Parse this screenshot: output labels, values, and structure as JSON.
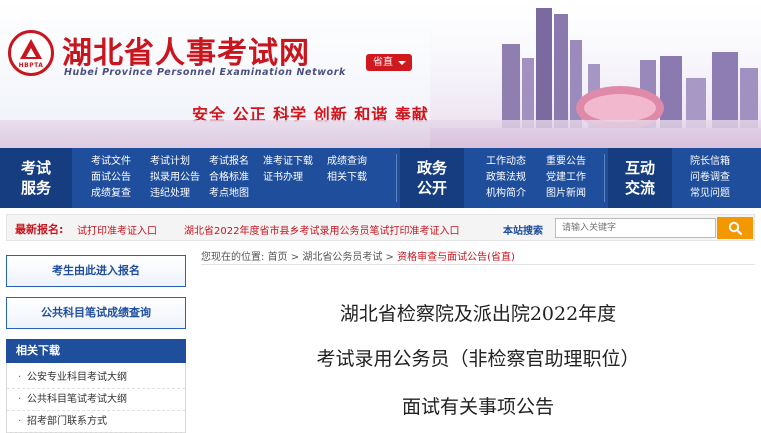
{
  "header": {
    "logo_abbr": "HBPTA",
    "site_title": "湖北省人事考试网",
    "site_subtitle": "Hubei Province Personnel Examination Network",
    "city_select": "省直",
    "slogan": "安全  公正  科学  创新  和谐  奉献"
  },
  "nav": {
    "groups": [
      {
        "title": [
          "考试",
          "服务"
        ],
        "links": [
          "考试文件",
          "考试计划",
          "考试报名",
          "准考证下载",
          "成绩查询",
          "面试公告",
          "拟录用公告",
          "合格标准",
          "证书办理",
          "相关下载",
          "成绩复查",
          "违纪处理",
          "考点地图"
        ]
      },
      {
        "title": [
          "政务",
          "公开"
        ],
        "links": [
          "工作动态",
          "重要公告",
          "政策法规",
          "党建工作",
          "机构简介",
          "图片新闻"
        ]
      },
      {
        "title": [
          "互动",
          "交流"
        ],
        "links": [
          "院长信箱",
          "问卷调查",
          "常见问题"
        ]
      }
    ]
  },
  "latest": {
    "label": "最新报名:",
    "items": [
      "试打印准考证入口",
      "湖北省2022年度省市县乡考试录用公务员笔试打印准考证入口"
    ],
    "search_label": "本站搜索",
    "search_placeholder": "请输入关键字"
  },
  "sidebar": {
    "buttons": [
      "考生由此进入报名",
      "公共科目笔试成绩查询"
    ],
    "downloads_title": "相关下载",
    "downloads": [
      "公安专业科目考试大纲",
      "公共科目笔试考试大纲",
      "招考部门联系方式"
    ]
  },
  "breadcrumb": {
    "prefix": "您现在的位置:",
    "items": [
      "首页",
      "湖北省公务员考试",
      "资格审查与面试公告(省直)"
    ],
    "separator": ">"
  },
  "article": {
    "title_lines": [
      "湖北省检察院及派出院2022年度",
      "考试录用公务员（非检察官助理职位）",
      "面试有关事项公告"
    ]
  },
  "colors": {
    "brand_red": "#c9151e",
    "nav_blue": "#1f4e9d",
    "search_orange": "#f39800"
  }
}
